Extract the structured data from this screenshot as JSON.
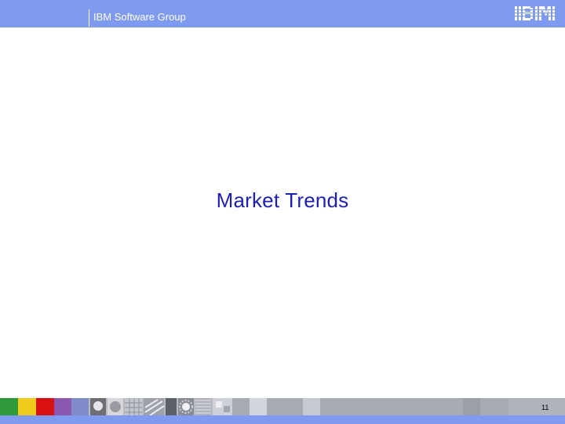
{
  "header": {
    "title": "IBM Software Group",
    "logo": "IBM",
    "background_color": "#7f9bf0"
  },
  "slide": {
    "title": "Market Trends",
    "title_color": "#1f1fb0"
  },
  "footer": {
    "page_number": "11",
    "swatch_colors": [
      "#2f9a3c",
      "#f0cc1a",
      "#d81010",
      "#8c57b0",
      "#7f8ccc"
    ],
    "band_color": "#a8aab4"
  }
}
